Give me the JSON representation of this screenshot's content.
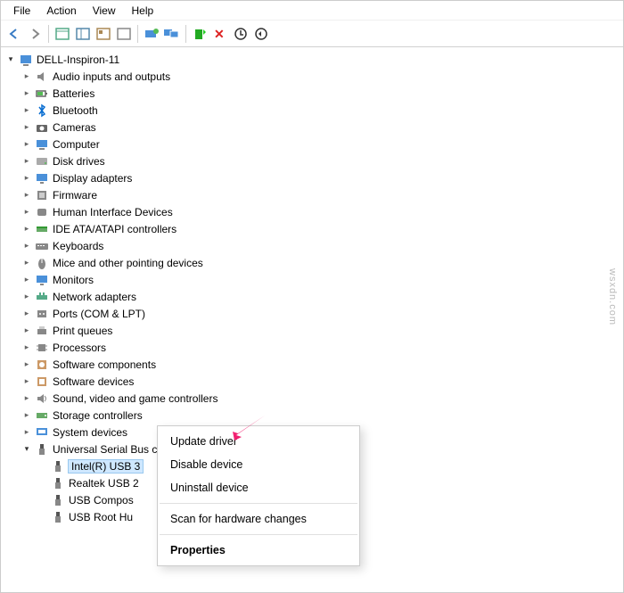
{
  "menubar": [
    "File",
    "Action",
    "View",
    "Help"
  ],
  "toolbar_icons": [
    "back",
    "forward",
    "sep",
    "frame1",
    "frame2",
    "frame3",
    "frame4",
    "sep",
    "update",
    "monitors",
    "sep",
    "enable",
    "disable",
    "uninstall",
    "scan"
  ],
  "root_label": "DELL-Inspiron-11",
  "categories": [
    {
      "label": "Audio inputs and outputs",
      "icon": "audio"
    },
    {
      "label": "Batteries",
      "icon": "battery"
    },
    {
      "label": "Bluetooth",
      "icon": "bluetooth"
    },
    {
      "label": "Cameras",
      "icon": "camera"
    },
    {
      "label": "Computer",
      "icon": "computer"
    },
    {
      "label": "Disk drives",
      "icon": "disk"
    },
    {
      "label": "Display adapters",
      "icon": "display"
    },
    {
      "label": "Firmware",
      "icon": "firmware"
    },
    {
      "label": "Human Interface Devices",
      "icon": "hid"
    },
    {
      "label": "IDE ATA/ATAPI controllers",
      "icon": "ide"
    },
    {
      "label": "Keyboards",
      "icon": "keyboard"
    },
    {
      "label": "Mice and other pointing devices",
      "icon": "mouse"
    },
    {
      "label": "Monitors",
      "icon": "monitor"
    },
    {
      "label": "Network adapters",
      "icon": "network"
    },
    {
      "label": "Ports (COM & LPT)",
      "icon": "port"
    },
    {
      "label": "Print queues",
      "icon": "printer"
    },
    {
      "label": "Processors",
      "icon": "cpu"
    },
    {
      "label": "Software components",
      "icon": "swcomp"
    },
    {
      "label": "Software devices",
      "icon": "swdev"
    },
    {
      "label": "Sound, video and game controllers",
      "icon": "sound"
    },
    {
      "label": "Storage controllers",
      "icon": "storage"
    },
    {
      "label": "System devices",
      "icon": "system"
    }
  ],
  "usb_category_label": "Universal Serial Bus controllers",
  "usb_children": [
    {
      "label": "Intel(R) USB 3",
      "selected": true
    },
    {
      "label": "Realtek USB 2"
    },
    {
      "label": "USB Compos"
    },
    {
      "label": "USB Root Hu"
    }
  ],
  "context_menu": {
    "items": [
      {
        "label": "Update driver"
      },
      {
        "label": "Disable device"
      },
      {
        "label": "Uninstall device"
      },
      {
        "sep": true
      },
      {
        "label": "Scan for hardware changes"
      },
      {
        "sep": true
      },
      {
        "label": "Properties",
        "bold": true
      }
    ]
  },
  "watermark": "wsxdn.com"
}
